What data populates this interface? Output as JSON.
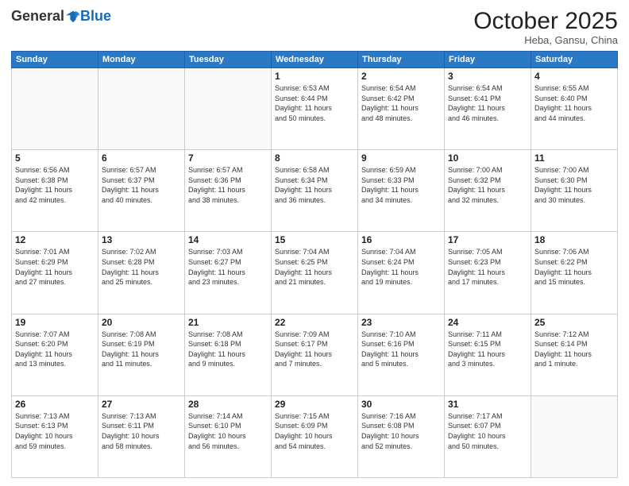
{
  "logo": {
    "general": "General",
    "blue": "Blue"
  },
  "header": {
    "month": "October 2025",
    "location": "Heba, Gansu, China"
  },
  "days_of_week": [
    "Sunday",
    "Monday",
    "Tuesday",
    "Wednesday",
    "Thursday",
    "Friday",
    "Saturday"
  ],
  "weeks": [
    [
      {
        "day": "",
        "info": ""
      },
      {
        "day": "",
        "info": ""
      },
      {
        "day": "",
        "info": ""
      },
      {
        "day": "1",
        "info": "Sunrise: 6:53 AM\nSunset: 6:44 PM\nDaylight: 11 hours\nand 50 minutes."
      },
      {
        "day": "2",
        "info": "Sunrise: 6:54 AM\nSunset: 6:42 PM\nDaylight: 11 hours\nand 48 minutes."
      },
      {
        "day": "3",
        "info": "Sunrise: 6:54 AM\nSunset: 6:41 PM\nDaylight: 11 hours\nand 46 minutes."
      },
      {
        "day": "4",
        "info": "Sunrise: 6:55 AM\nSunset: 6:40 PM\nDaylight: 11 hours\nand 44 minutes."
      }
    ],
    [
      {
        "day": "5",
        "info": "Sunrise: 6:56 AM\nSunset: 6:38 PM\nDaylight: 11 hours\nand 42 minutes."
      },
      {
        "day": "6",
        "info": "Sunrise: 6:57 AM\nSunset: 6:37 PM\nDaylight: 11 hours\nand 40 minutes."
      },
      {
        "day": "7",
        "info": "Sunrise: 6:57 AM\nSunset: 6:36 PM\nDaylight: 11 hours\nand 38 minutes."
      },
      {
        "day": "8",
        "info": "Sunrise: 6:58 AM\nSunset: 6:34 PM\nDaylight: 11 hours\nand 36 minutes."
      },
      {
        "day": "9",
        "info": "Sunrise: 6:59 AM\nSunset: 6:33 PM\nDaylight: 11 hours\nand 34 minutes."
      },
      {
        "day": "10",
        "info": "Sunrise: 7:00 AM\nSunset: 6:32 PM\nDaylight: 11 hours\nand 32 minutes."
      },
      {
        "day": "11",
        "info": "Sunrise: 7:00 AM\nSunset: 6:30 PM\nDaylight: 11 hours\nand 30 minutes."
      }
    ],
    [
      {
        "day": "12",
        "info": "Sunrise: 7:01 AM\nSunset: 6:29 PM\nDaylight: 11 hours\nand 27 minutes."
      },
      {
        "day": "13",
        "info": "Sunrise: 7:02 AM\nSunset: 6:28 PM\nDaylight: 11 hours\nand 25 minutes."
      },
      {
        "day": "14",
        "info": "Sunrise: 7:03 AM\nSunset: 6:27 PM\nDaylight: 11 hours\nand 23 minutes."
      },
      {
        "day": "15",
        "info": "Sunrise: 7:04 AM\nSunset: 6:25 PM\nDaylight: 11 hours\nand 21 minutes."
      },
      {
        "day": "16",
        "info": "Sunrise: 7:04 AM\nSunset: 6:24 PM\nDaylight: 11 hours\nand 19 minutes."
      },
      {
        "day": "17",
        "info": "Sunrise: 7:05 AM\nSunset: 6:23 PM\nDaylight: 11 hours\nand 17 minutes."
      },
      {
        "day": "18",
        "info": "Sunrise: 7:06 AM\nSunset: 6:22 PM\nDaylight: 11 hours\nand 15 minutes."
      }
    ],
    [
      {
        "day": "19",
        "info": "Sunrise: 7:07 AM\nSunset: 6:20 PM\nDaylight: 11 hours\nand 13 minutes."
      },
      {
        "day": "20",
        "info": "Sunrise: 7:08 AM\nSunset: 6:19 PM\nDaylight: 11 hours\nand 11 minutes."
      },
      {
        "day": "21",
        "info": "Sunrise: 7:08 AM\nSunset: 6:18 PM\nDaylight: 11 hours\nand 9 minutes."
      },
      {
        "day": "22",
        "info": "Sunrise: 7:09 AM\nSunset: 6:17 PM\nDaylight: 11 hours\nand 7 minutes."
      },
      {
        "day": "23",
        "info": "Sunrise: 7:10 AM\nSunset: 6:16 PM\nDaylight: 11 hours\nand 5 minutes."
      },
      {
        "day": "24",
        "info": "Sunrise: 7:11 AM\nSunset: 6:15 PM\nDaylight: 11 hours\nand 3 minutes."
      },
      {
        "day": "25",
        "info": "Sunrise: 7:12 AM\nSunset: 6:14 PM\nDaylight: 11 hours\nand 1 minute."
      }
    ],
    [
      {
        "day": "26",
        "info": "Sunrise: 7:13 AM\nSunset: 6:13 PM\nDaylight: 10 hours\nand 59 minutes."
      },
      {
        "day": "27",
        "info": "Sunrise: 7:13 AM\nSunset: 6:11 PM\nDaylight: 10 hours\nand 58 minutes."
      },
      {
        "day": "28",
        "info": "Sunrise: 7:14 AM\nSunset: 6:10 PM\nDaylight: 10 hours\nand 56 minutes."
      },
      {
        "day": "29",
        "info": "Sunrise: 7:15 AM\nSunset: 6:09 PM\nDaylight: 10 hours\nand 54 minutes."
      },
      {
        "day": "30",
        "info": "Sunrise: 7:16 AM\nSunset: 6:08 PM\nDaylight: 10 hours\nand 52 minutes."
      },
      {
        "day": "31",
        "info": "Sunrise: 7:17 AM\nSunset: 6:07 PM\nDaylight: 10 hours\nand 50 minutes."
      },
      {
        "day": "",
        "info": ""
      }
    ]
  ]
}
